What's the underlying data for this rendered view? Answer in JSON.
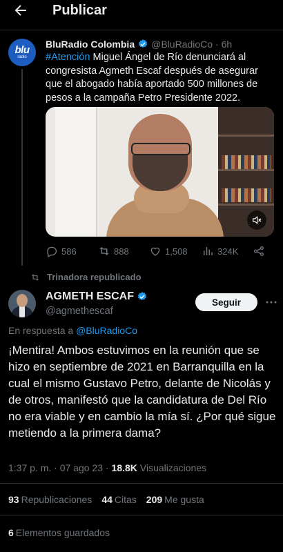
{
  "header": {
    "title": "Publicar"
  },
  "quoted": {
    "name": "BluRadio Colombia",
    "handle": "@BluRadioCo",
    "time": "· 6h",
    "avatar_text": "blu",
    "avatar_subtext": "radio",
    "hashtag": "#Atención",
    "text": " Miguel Ángel de Río denunciará al congresista Agmeth Escaf después de asegurar que el abogado había aportado 500 millones de pesos a la campaña Petro Presidente 2022.",
    "actions": {
      "replies": "586",
      "reposts": "888",
      "likes": "1,508",
      "views": "324K"
    }
  },
  "repost_label": "Trinadora republicado",
  "post": {
    "name": "AGMETH ESCAF",
    "handle": "@agmethescaf",
    "follow_label": "Seguir",
    "reply_prefix": "En respuesta a ",
    "reply_to": "@BluRadioCo",
    "text": "¡Mentira! Ambos estuvimos en la reunión que se hizo en septiembre de 2021 en Barranquilla en la cual el mismo Gustavo Petro, delante de Nicolás y de otros, manifestó que la candidatura de Del Río no era viable y en cambio la mía sí. ¿Por qué sigue metiendo a la primera dama?",
    "timestamp": "1:37 p. m. · 07 ago 23 · ",
    "views_count": "18.8K",
    "views_label": "Visualizaciones",
    "stats": {
      "reposts_count": "93",
      "reposts_label": "Republicaciones",
      "quotes_count": "44",
      "quotes_label": "Citas",
      "likes_count": "209",
      "likes_label": "Me gusta"
    },
    "bookmarks_count": "6",
    "bookmarks_label": "Elementos guardados"
  },
  "colors": {
    "background": "#000000",
    "text": "#e7e9ea",
    "muted": "#71767b",
    "accent": "#1d9bf0"
  },
  "icons": [
    "back-arrow-icon",
    "verified-icon",
    "reply-icon",
    "repost-icon",
    "like-icon",
    "views-icon",
    "share-icon",
    "mute-icon",
    "more-icon"
  ]
}
